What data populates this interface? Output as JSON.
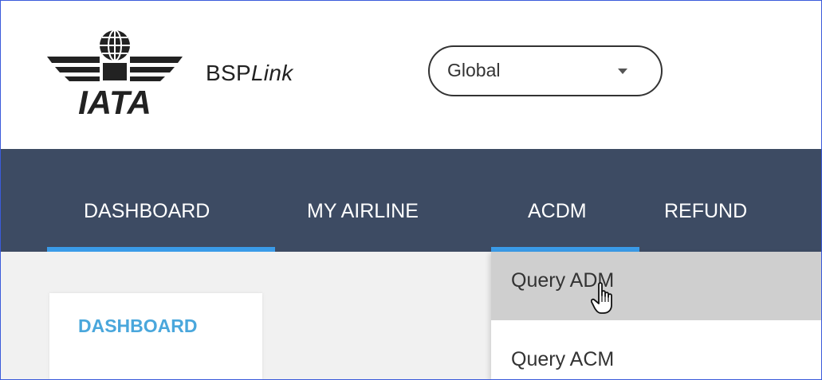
{
  "header": {
    "logo_text": "IATA",
    "app_name_prefix": "BSP",
    "app_name_suffix": "Link",
    "scope_select": {
      "value": "Global"
    }
  },
  "nav": {
    "items": [
      {
        "label": "DASHBOARD",
        "active": true
      },
      {
        "label": "MY AIRLINE",
        "active": false
      },
      {
        "label": "ACDM",
        "active": true
      },
      {
        "label": "REFUND",
        "active": false
      }
    ]
  },
  "dropdown": {
    "items": [
      {
        "label": "Query ADM",
        "hover": true
      },
      {
        "label": "Query ACM",
        "hover": false
      }
    ]
  },
  "content": {
    "tab_label": "DASHBOARD"
  },
  "colors": {
    "nav_bg": "#3d4b63",
    "accent": "#3a9be8",
    "tab_text": "#4aa7dc",
    "hover_bg": "#cfcfcf"
  }
}
